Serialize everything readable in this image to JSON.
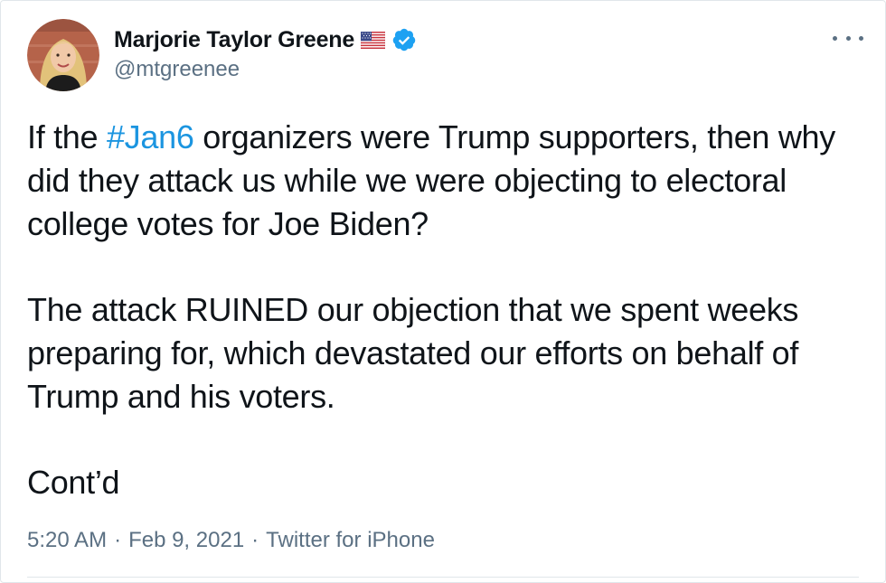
{
  "author": {
    "display_name": "Marjorie Taylor Greene",
    "handle": "@mtgreenee",
    "flag_icon": "us-flag-icon",
    "verified_icon": "verified-badge-icon",
    "verified_color": "#1da1f2"
  },
  "more_icon": "more-options-icon",
  "tweet": {
    "p1_before": "If the ",
    "hashtag": "#Jan6",
    "p1_after": " organizers were Trump supporters, then why did they attack us while we were objecting to electoral college votes for Joe Biden?",
    "p2": "The attack RUINED our objection that we spent weeks preparing for, which devastated our efforts on behalf of Trump and his voters.",
    "p3": "Cont’d",
    "hashtag_color": "#1b95e0"
  },
  "meta": {
    "time": "5:20 AM",
    "separator": "·",
    "date": "Feb 9, 2021",
    "source": "Twitter for iPhone",
    "color": "#5b7083"
  }
}
